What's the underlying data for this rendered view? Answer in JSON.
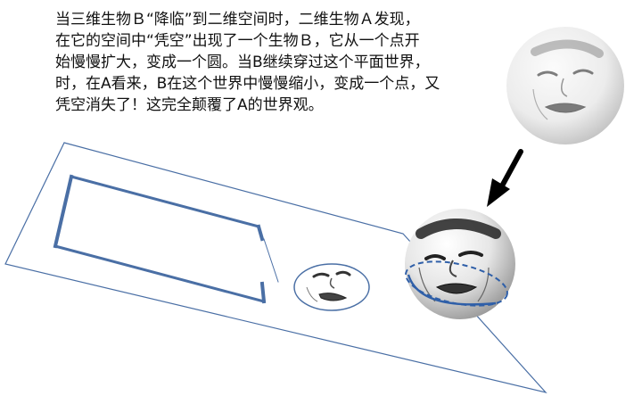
{
  "description": {
    "lines": [
      "当三维生物Ｂ“降临”到二维空间时，二维生物Ａ发现，",
      "在它的空间中“凭空”出现了一个生物Ｂ，它从一个点开",
      "始慢慢扩大，变成一个圆。当B继续穿过这个平面世界，",
      "时，在A看来，B在这个世界中慢慢缩小，变成一个点，又",
      "凭空消失了！这完全颠覆了A的世界观。"
    ]
  },
  "figures": {
    "upper_sphere": {
      "depicts": "face-sphere"
    },
    "arrow": {
      "direction": "down-left",
      "color": "#000000"
    },
    "lower_sphere": {
      "depicts": "face-sphere",
      "intersect_color": "#2f5fa8"
    },
    "flat_face": {
      "depicts": "face-circle"
    },
    "plane": {
      "color": "#4a6fa5"
    },
    "creature_outline": {
      "color": "#4a6fa5"
    }
  }
}
